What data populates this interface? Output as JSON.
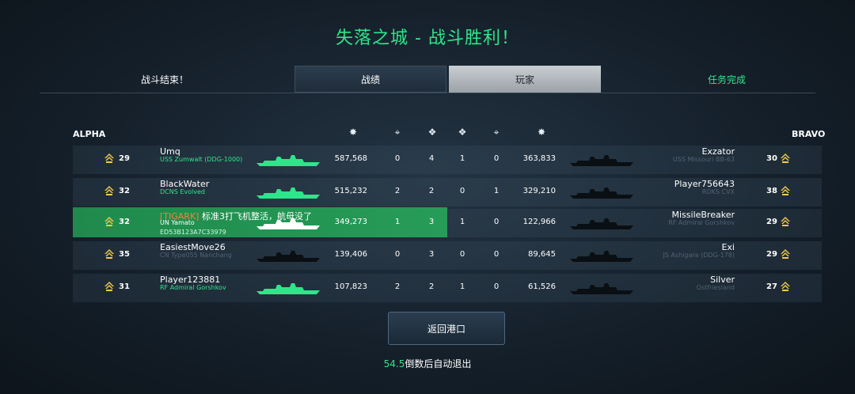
{
  "title": "失落之城 - 战斗胜利！",
  "battle_end": "战斗结束！",
  "mission": "任务完成",
  "tabs": {
    "stats": "战绩",
    "players": "玩家"
  },
  "teams": {
    "alpha": "ALPHA",
    "bravo": "BRAVO"
  },
  "column_icons": [
    "damage-icon",
    "crosshair-icon",
    "eagle-icon",
    "eagle-icon",
    "crosshair-icon",
    "damage-icon"
  ],
  "alpha": [
    {
      "level": "29",
      "name": "Umq",
      "ship": "USS Zumwalt (DDG-1000)",
      "damage": "587,568",
      "c1": "0",
      "c2": "4"
    },
    {
      "level": "32",
      "name": "BlackWater",
      "ship": "DCNS Evolved",
      "damage": "515,232",
      "c1": "2",
      "c2": "2"
    },
    {
      "level": "32",
      "tag": "[TIGARK]",
      "name": "标准3打飞机整活，航母没了",
      "ship": "UN Yamato",
      "uid": "ED53B123A7C33979",
      "damage": "349,273",
      "c1": "1",
      "c2": "3"
    },
    {
      "level": "35",
      "name": "EasiestMove26",
      "ship": "CN Type055 Nanchang",
      "damage": "139,406",
      "c1": "0",
      "c2": "3"
    },
    {
      "level": "31",
      "name": "Player123881",
      "ship": "RF Admiral Gorshkov",
      "damage": "107,823",
      "c1": "2",
      "c2": "2"
    }
  ],
  "bravo": [
    {
      "level": "30",
      "name": "Exzator",
      "ship": "USS Missouri BB-63",
      "damage": "363,833",
      "c1": "1",
      "c2": "0"
    },
    {
      "level": "38",
      "name": "Player756643",
      "ship": "ROKS CVX",
      "damage": "329,210",
      "c1": "0",
      "c2": "1"
    },
    {
      "level": "29",
      "name": "MissileBreaker",
      "ship": "RF Admiral Gorshkov",
      "damage": "122,966",
      "c1": "1",
      "c2": "0"
    },
    {
      "level": "29",
      "name": "Exi",
      "ship": "JS Ashigara (DDG-178)",
      "damage": "89,645",
      "c1": "0",
      "c2": "0"
    },
    {
      "level": "27",
      "name": "Silver",
      "ship": "Ostfriesland",
      "damage": "61,526",
      "c1": "1",
      "c2": "0"
    }
  ],
  "return_button": "返回港口",
  "countdown": {
    "seconds": "54.5",
    "text": "倒数后自动退出"
  },
  "colors": {
    "accent": "#2ee68a",
    "highlight_row": "#279c58",
    "clan_tag": "#ff7d3b"
  }
}
